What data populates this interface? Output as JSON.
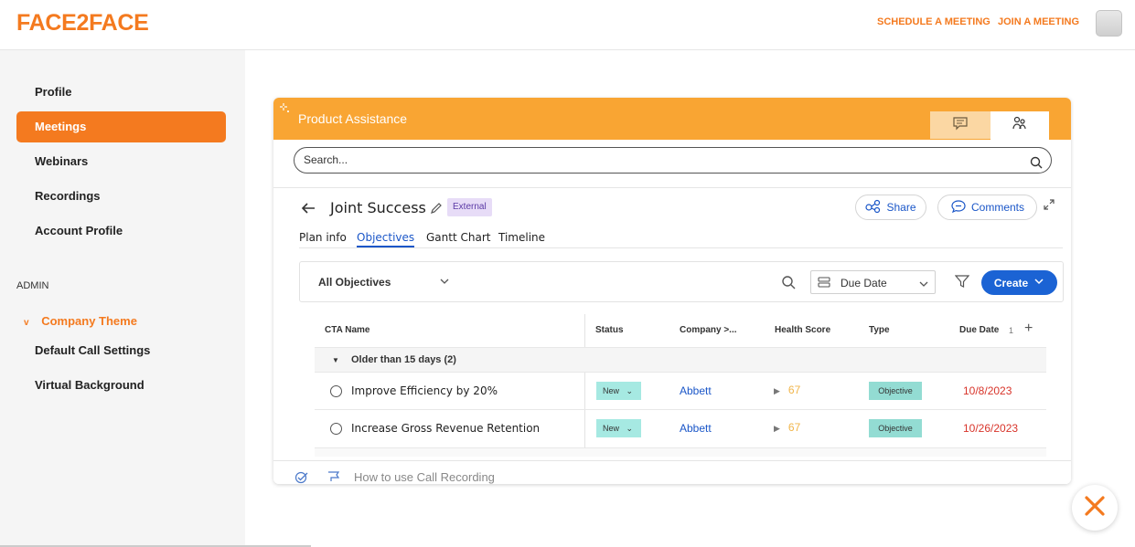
{
  "app": {
    "logo": "FACE2FACE"
  },
  "header": {
    "schedule_link": "SCHEDULE A MEETING",
    "join_link": "JOIN A MEETING"
  },
  "sidebar": {
    "items": [
      {
        "label": "Profile",
        "active": false
      },
      {
        "label": "Meetings",
        "active": true
      },
      {
        "label": "Webinars",
        "active": false
      },
      {
        "label": "Recordings",
        "active": false
      },
      {
        "label": "Account Profile",
        "active": false
      }
    ],
    "admin_label": "ADMIN",
    "admin_group": {
      "chevron": "v",
      "label": "Company Theme"
    },
    "admin_items": [
      {
        "label": "Default Call Settings"
      },
      {
        "label": "Virtual Background"
      }
    ]
  },
  "assist": {
    "title": "Product Assistance",
    "search_placeholder": "Search...",
    "page_title": "Joint Success",
    "badge": "External",
    "share_label": "Share",
    "comments_label": "Comments",
    "tabs": [
      {
        "label": "Plan info",
        "active": false
      },
      {
        "label": "Objectives",
        "active": true
      },
      {
        "label": "Gantt Chart",
        "active": false
      },
      {
        "label": "Timeline",
        "active": false
      }
    ],
    "filter_label": "All Objectives",
    "sort_label": "Due Date",
    "create_label": "Create",
    "columns": [
      "CTA Name",
      "Status",
      "Company >...",
      "Health Score",
      "Type",
      "Due Date"
    ],
    "sort_indicator": "1",
    "add_column": "+",
    "group_label": "Older than 15 days (2)",
    "rows": [
      {
        "name": "Improve Efficiency by 20%",
        "status": "New",
        "company": "Abbett",
        "health": "67",
        "type": "Objective",
        "due": "10/8/2023"
      },
      {
        "name": "Increase Gross Revenue Retention",
        "status": "New",
        "company": "Abbett",
        "health": "67",
        "type": "Objective",
        "due": "10/26/2023"
      }
    ],
    "footer_text": "How to use Call Recording"
  },
  "colors": {
    "brand": "#f47a1f",
    "assist_header": "#f9a533",
    "link_blue": "#1a56c8",
    "due_red": "#d8342a"
  },
  "icons": [
    "sparkle-icon",
    "chat-icon",
    "people-icon",
    "search-icon",
    "back-arrow-icon",
    "pencil-icon",
    "share-icon",
    "comments-icon",
    "expand-icon",
    "chevron-down-icon",
    "sort-icon",
    "filter-icon",
    "caret-right-icon",
    "check-icon",
    "feedback-icon",
    "close-icon"
  ]
}
